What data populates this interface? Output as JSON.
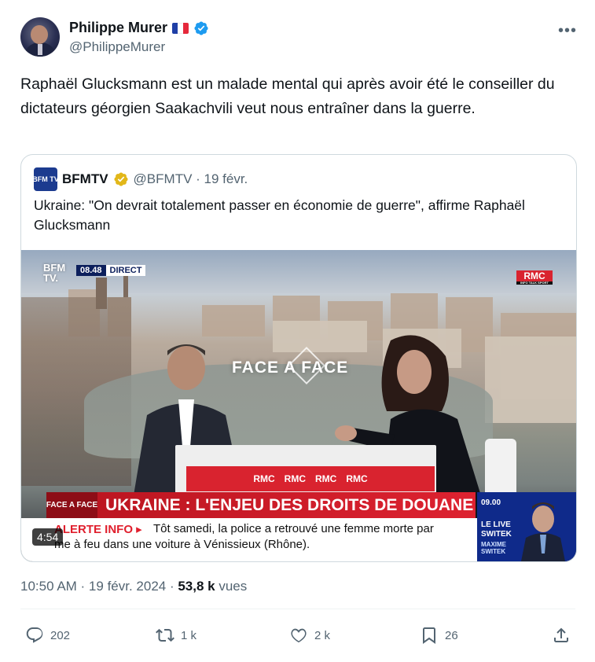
{
  "author": {
    "name": "Philippe Murer",
    "handle": "@PhilippeMurer",
    "flag": "french-flag",
    "verified_color": "#1d9bf0"
  },
  "tweet": {
    "text": "Raphaël Glucksmann est un malade mental qui après avoir été le conseiller du dictateurs géorgien Saakachvili veut nous entraîner dans la guerre."
  },
  "quote": {
    "logo_text": "BFM TV",
    "name": "BFMTV",
    "handle_date": "@BFMTV · 19 févr.",
    "text": "Ukraine: \"On devrait totalement passer en économie de guerre\", affirme Raphaël Glucksmann",
    "video": {
      "channel": "BFM TV.",
      "time": "08.48",
      "live_label": "DIRECT",
      "rmc": "RMC",
      "rmc_sub": "INFO TALK SPORT",
      "show": "FACE A FACE",
      "desk_labels": [
        "RMC",
        "RMC",
        "RMC",
        "RMC"
      ],
      "banner_tag": "FACE A FACE",
      "headline": "UKRAINE : L'ENJEU DES DROITS DE DOUANE",
      "alert_label": "ALERTE INFO ▸",
      "alert_line1": "Tôt samedi, la police a retrouvé une femme morte par",
      "alert_line2": "me à feu dans une voiture à Vénissieux (Rhône).",
      "side_time": "09.00",
      "side_title": "LE LIVE\nSWITEK",
      "side_name": "MAXIME\nSWITEK",
      "duration": "4:54"
    }
  },
  "meta": {
    "time": "10:50 AM · 19 févr. 2024 · ",
    "views_count": "53,8 k",
    "views_label": " vues"
  },
  "actions": {
    "replies": "202",
    "reposts": "1 k",
    "likes": "2 k",
    "bookmarks": "26"
  }
}
